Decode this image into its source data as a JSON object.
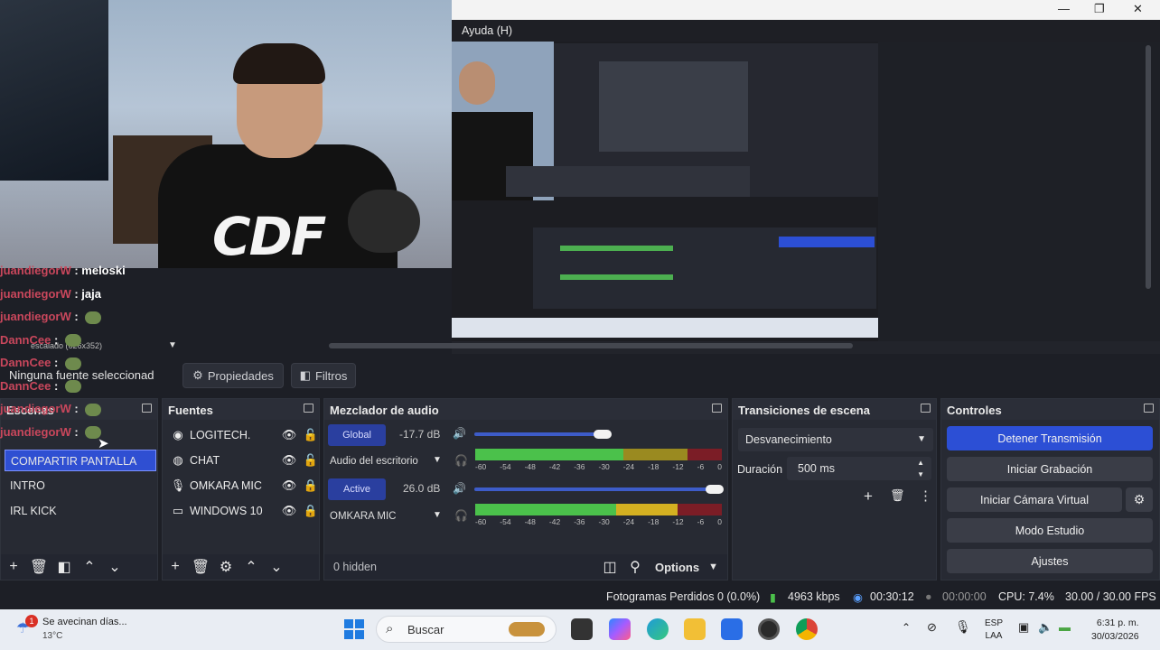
{
  "window": {
    "title": "Ayuda (H)"
  },
  "camera": {
    "shirt_logo": "CDF"
  },
  "chat": [
    {
      "user": "juandiegorW",
      "msg": "meloski"
    },
    {
      "user": "juandiegorW",
      "msg": "jaja"
    },
    {
      "user": "juandiegorW",
      "msg": ""
    },
    {
      "user": "DannCee",
      "msg": ""
    },
    {
      "user": "DannCee",
      "msg": ""
    },
    {
      "user": "DannCee",
      "msg": ""
    },
    {
      "user": "juandiegorW",
      "msg": ""
    },
    {
      "user": "juandiegorW",
      "msg": ""
    }
  ],
  "sourcebar": {
    "no_source": "Ninguna fuente seleccionad",
    "properties": "Propiedades",
    "filters": "Filtros",
    "scaled": "escalado (626x352)"
  },
  "scenes": {
    "title": "Escenas",
    "items": [
      "COMPARTIR PANTALLA",
      "INTRO",
      "IRL KICK"
    ],
    "selected": 0
  },
  "sources": {
    "title": "Fuentes",
    "items": [
      {
        "name": "LOGITECH.",
        "icon": "camera-icon"
      },
      {
        "name": "CHAT",
        "icon": "globe-icon"
      },
      {
        "name": "OMKARA MIC",
        "icon": "microphone-icon"
      },
      {
        "name": "WINDOWS 10",
        "icon": "monitor-icon"
      }
    ]
  },
  "mixer": {
    "title": "Mezclador de audio",
    "channels": [
      {
        "chip": "Global",
        "db": "-17.7 dB",
        "name": "Audio del escritorio",
        "level": 0.52
      },
      {
        "chip": "Active",
        "db": "26.0 dB",
        "name": "OMKARA MIC",
        "level": 0.97
      }
    ],
    "ticks": [
      "-60",
      "-54",
      "-48",
      "-42",
      "-36",
      "-30",
      "-24",
      "-18",
      "-12",
      "-6",
      "0"
    ],
    "hidden": "0 hidden",
    "options": "Options"
  },
  "transitions": {
    "title": "Transiciones de escena",
    "selected": "Desvanecimiento",
    "duration_label": "Duración",
    "duration_value": "500 ms"
  },
  "controls": {
    "title": "Controles",
    "buttons": [
      "Detener Transmisión",
      "Iniciar Grabación",
      "Iniciar Cámara Virtual",
      "Modo Estudio",
      "Ajustes"
    ]
  },
  "status": {
    "dropped": "Fotogramas Perdidos 0 (0.0%)",
    "kbps": "4963 kbps",
    "stream_time": "00:30:12",
    "rec_time": "00:00:00",
    "cpu": "CPU: 7.4%",
    "fps": "30.00 / 30.00 FPS"
  },
  "taskbar": {
    "weather_title": "Se avecinan días...",
    "weather_temp": "13°C",
    "weather_badge": "1",
    "search": "Buscar",
    "lang_top": "ESP",
    "lang_bottom": "LAA",
    "time": "6:31 p. m.",
    "date": "30/03/2026"
  },
  "colors": {
    "accent": "#2c4fd5",
    "chat_user": "#c9475c"
  }
}
